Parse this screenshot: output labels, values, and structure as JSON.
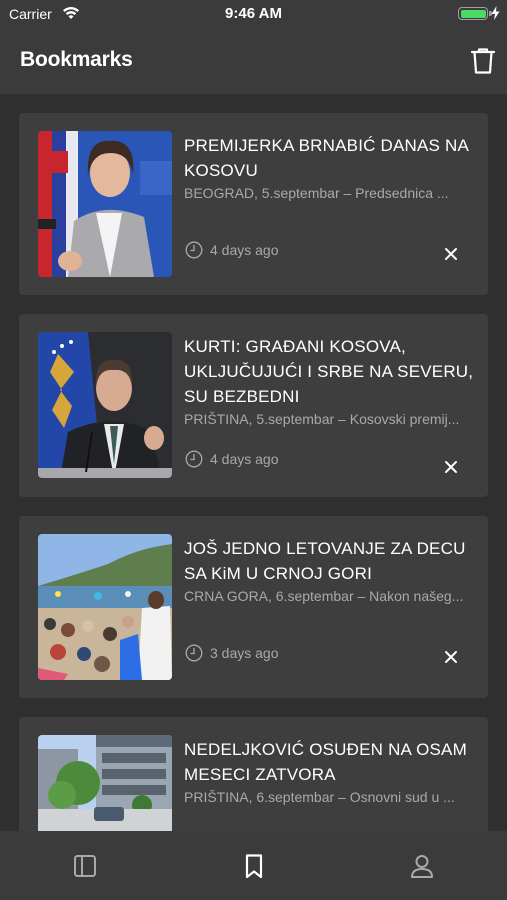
{
  "status_bar": {
    "carrier": "Carrier",
    "time": "9:46 AM",
    "battery_color": "#4cd964"
  },
  "header": {
    "title": "Bookmarks",
    "action_icon": "trash-icon"
  },
  "bookmarks": [
    {
      "title": "PREMIJERKA BRNABIĆ DANAS NA KOSOVU",
      "excerpt": "BEOGRAD, 5.septembar – Predsednica ...",
      "time": "4 days ago",
      "thumbnail": "woman-at-podium-with-serbian-flag"
    },
    {
      "title": "KURTI: GRAĐANI KOSOVA, UKLJUČUJUĆI I SRBE NA SEVERU, SU BEZBEDNI",
      "excerpt": "PRIŠTINA, 5.septembar – Kosovski premij...",
      "time": "4 days ago",
      "thumbnail": "man-speaking-with-kosovo-flag"
    },
    {
      "title": "JOŠ JEDNO LETOVANJE ZA DECU SA KiM U CRNOJ GORI",
      "excerpt": "CRNA GORA, 6.septembar – Nakon našeg...",
      "time": "3 days ago",
      "thumbnail": "crowded-beach"
    },
    {
      "title": "NEDELJKOVIĆ OSUĐEN NA OSAM MESECI ZATVORA",
      "excerpt": "PRIŠTINA, 6.septembar – Osnovni sud u ...",
      "time": "",
      "thumbnail": "courthouse-building"
    }
  ],
  "tab_bar": {
    "tabs": [
      {
        "icon": "sidebar-icon",
        "active": false
      },
      {
        "icon": "bookmark-icon",
        "active": true
      },
      {
        "icon": "profile-icon",
        "active": false
      }
    ]
  },
  "colors": {
    "background": "#2f2f30",
    "bar": "#3b3b3c",
    "card": "#3e3e3f",
    "secondary_text": "#a9a9ab"
  }
}
